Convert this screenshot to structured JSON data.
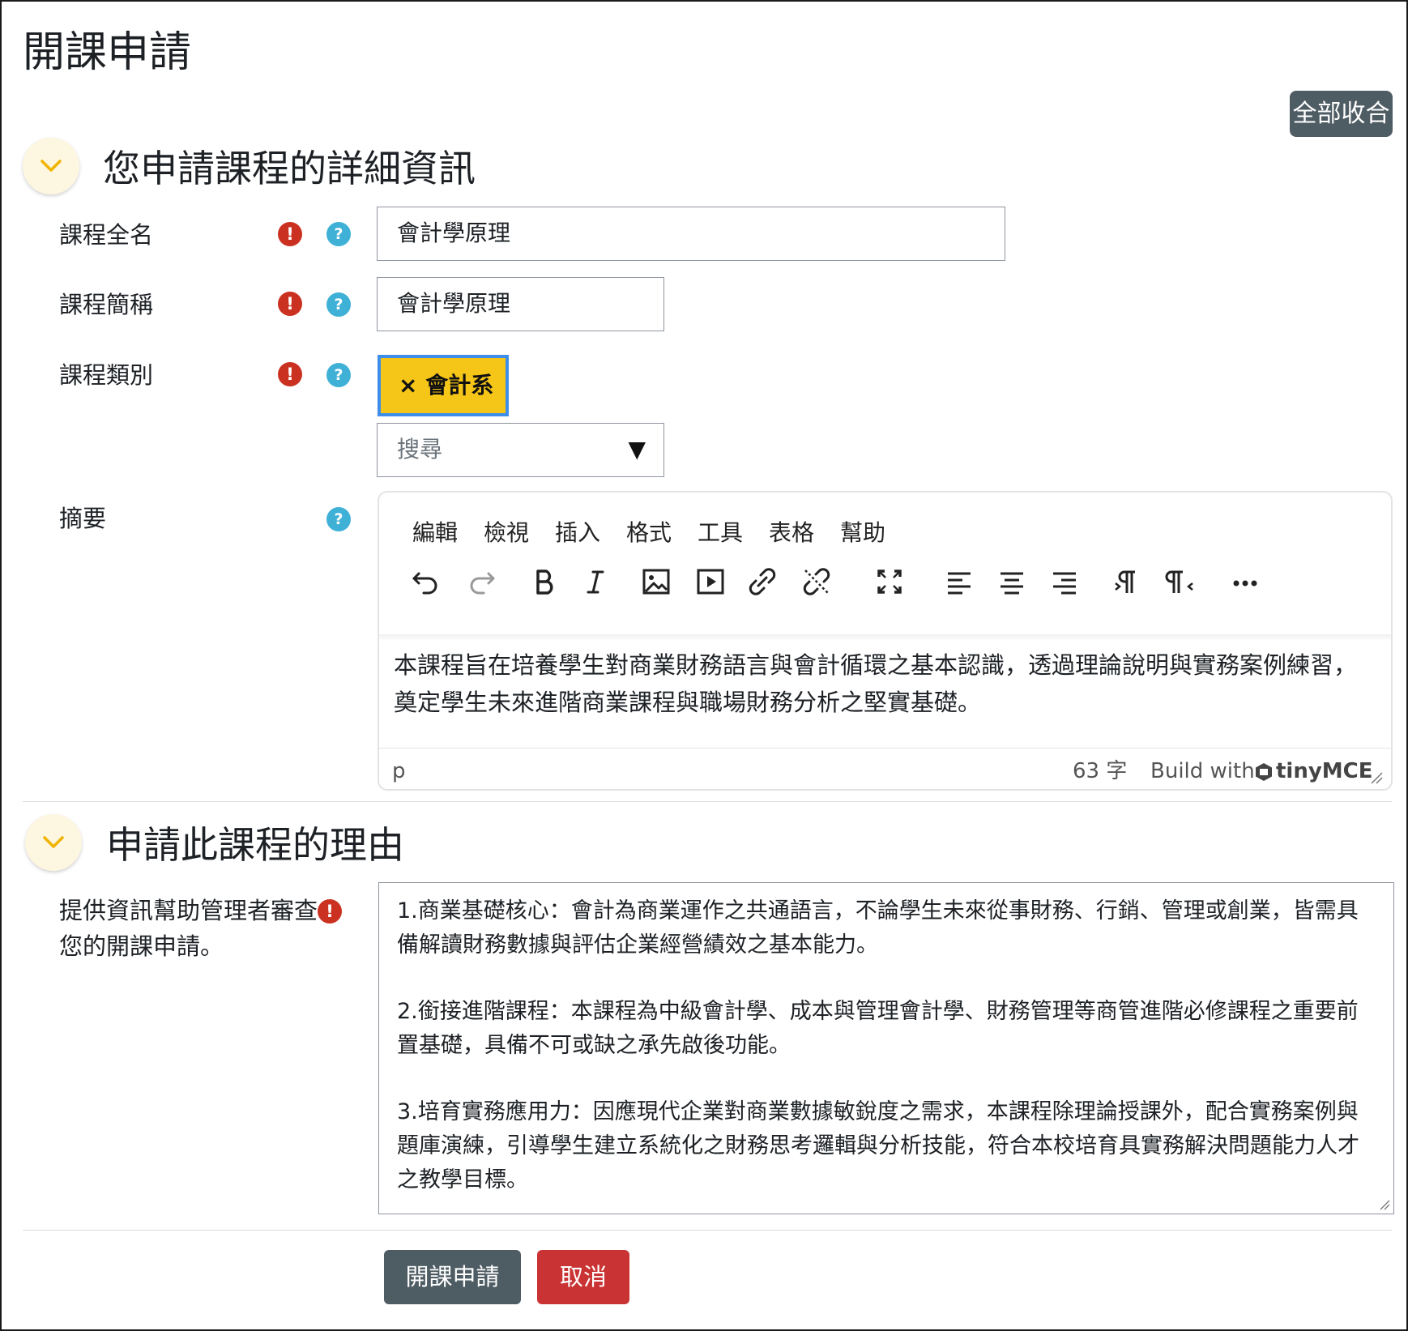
{
  "page": {
    "title": "開課申請",
    "collapse_all_label": "全部收合"
  },
  "section_details": {
    "title": "您申請課程的詳細資訊",
    "fields": {
      "fullname": {
        "label": "課程全名",
        "value": "會計學原理"
      },
      "shortname": {
        "label": "課程簡稱",
        "value": "會計學原理"
      },
      "category": {
        "label": "課程類別",
        "selected_tag": "會計系",
        "tag_remove_symbol": "×",
        "search_placeholder": "搜尋",
        "dropdown_arrow": "▼"
      },
      "summary": {
        "label": "摘要",
        "menu": [
          "編輯",
          "檢視",
          "插入",
          "格式",
          "工具",
          "表格",
          "幫助"
        ],
        "toolbar": [
          "undo-icon",
          "redo-icon",
          "bold-icon",
          "italic-icon",
          "image-icon",
          "media-icon",
          "link-icon",
          "unlink-icon",
          "fullscreen-icon",
          "align-left-icon",
          "align-center-icon",
          "align-right-icon",
          "ltr-icon",
          "rtl-icon",
          "more-icon"
        ],
        "content": "本課程旨在培養學生對商業財務語言與會計循環之基本認識，透過理論說明與實務案例練習，奠定學生未來進階商業課程與職場財務分析之堅實基礎。",
        "status_path": "p",
        "word_count": "63 字",
        "branding_prefix": "Build with",
        "branding_name": "tinyMCE"
      }
    }
  },
  "section_reason": {
    "title": "申請此課程的理由",
    "label": "提供資訊幫助管理者審查您的開課申請。",
    "paragraphs": [
      "1.商業基礎核心：會計為商業運作之共通語言，不論學生未來從事財務、行銷、管理或創業，皆需具備解讀財務數據與評估企業經營績效之基本能力。",
      "2.銜接進階課程：本課程為中級會計學、成本與管理會計學、財務管理等商管進階必修課程之重要前置基礎，具備不可或缺之承先啟後功能。",
      "3.培育實務應用力：因應現代企業對商業數據敏銳度之需求，本課程除理論授課外，配合實務案例與題庫演練，引導學生建立系統化之財務思考邏輯與分析技能，符合本校培育具實務解決問題能力人才之教學目標。"
    ]
  },
  "actions": {
    "submit_label": "開課申請",
    "cancel_label": "取消"
  },
  "icons": {
    "required": "!",
    "help": "?"
  },
  "colors": {
    "primary_button": "#4e5c63",
    "danger_button": "#ca3333",
    "required_icon": "#ca3120",
    "help_icon": "#3fb1d6",
    "tag_background": "#f5c518",
    "tag_border": "#3d8ee8"
  }
}
